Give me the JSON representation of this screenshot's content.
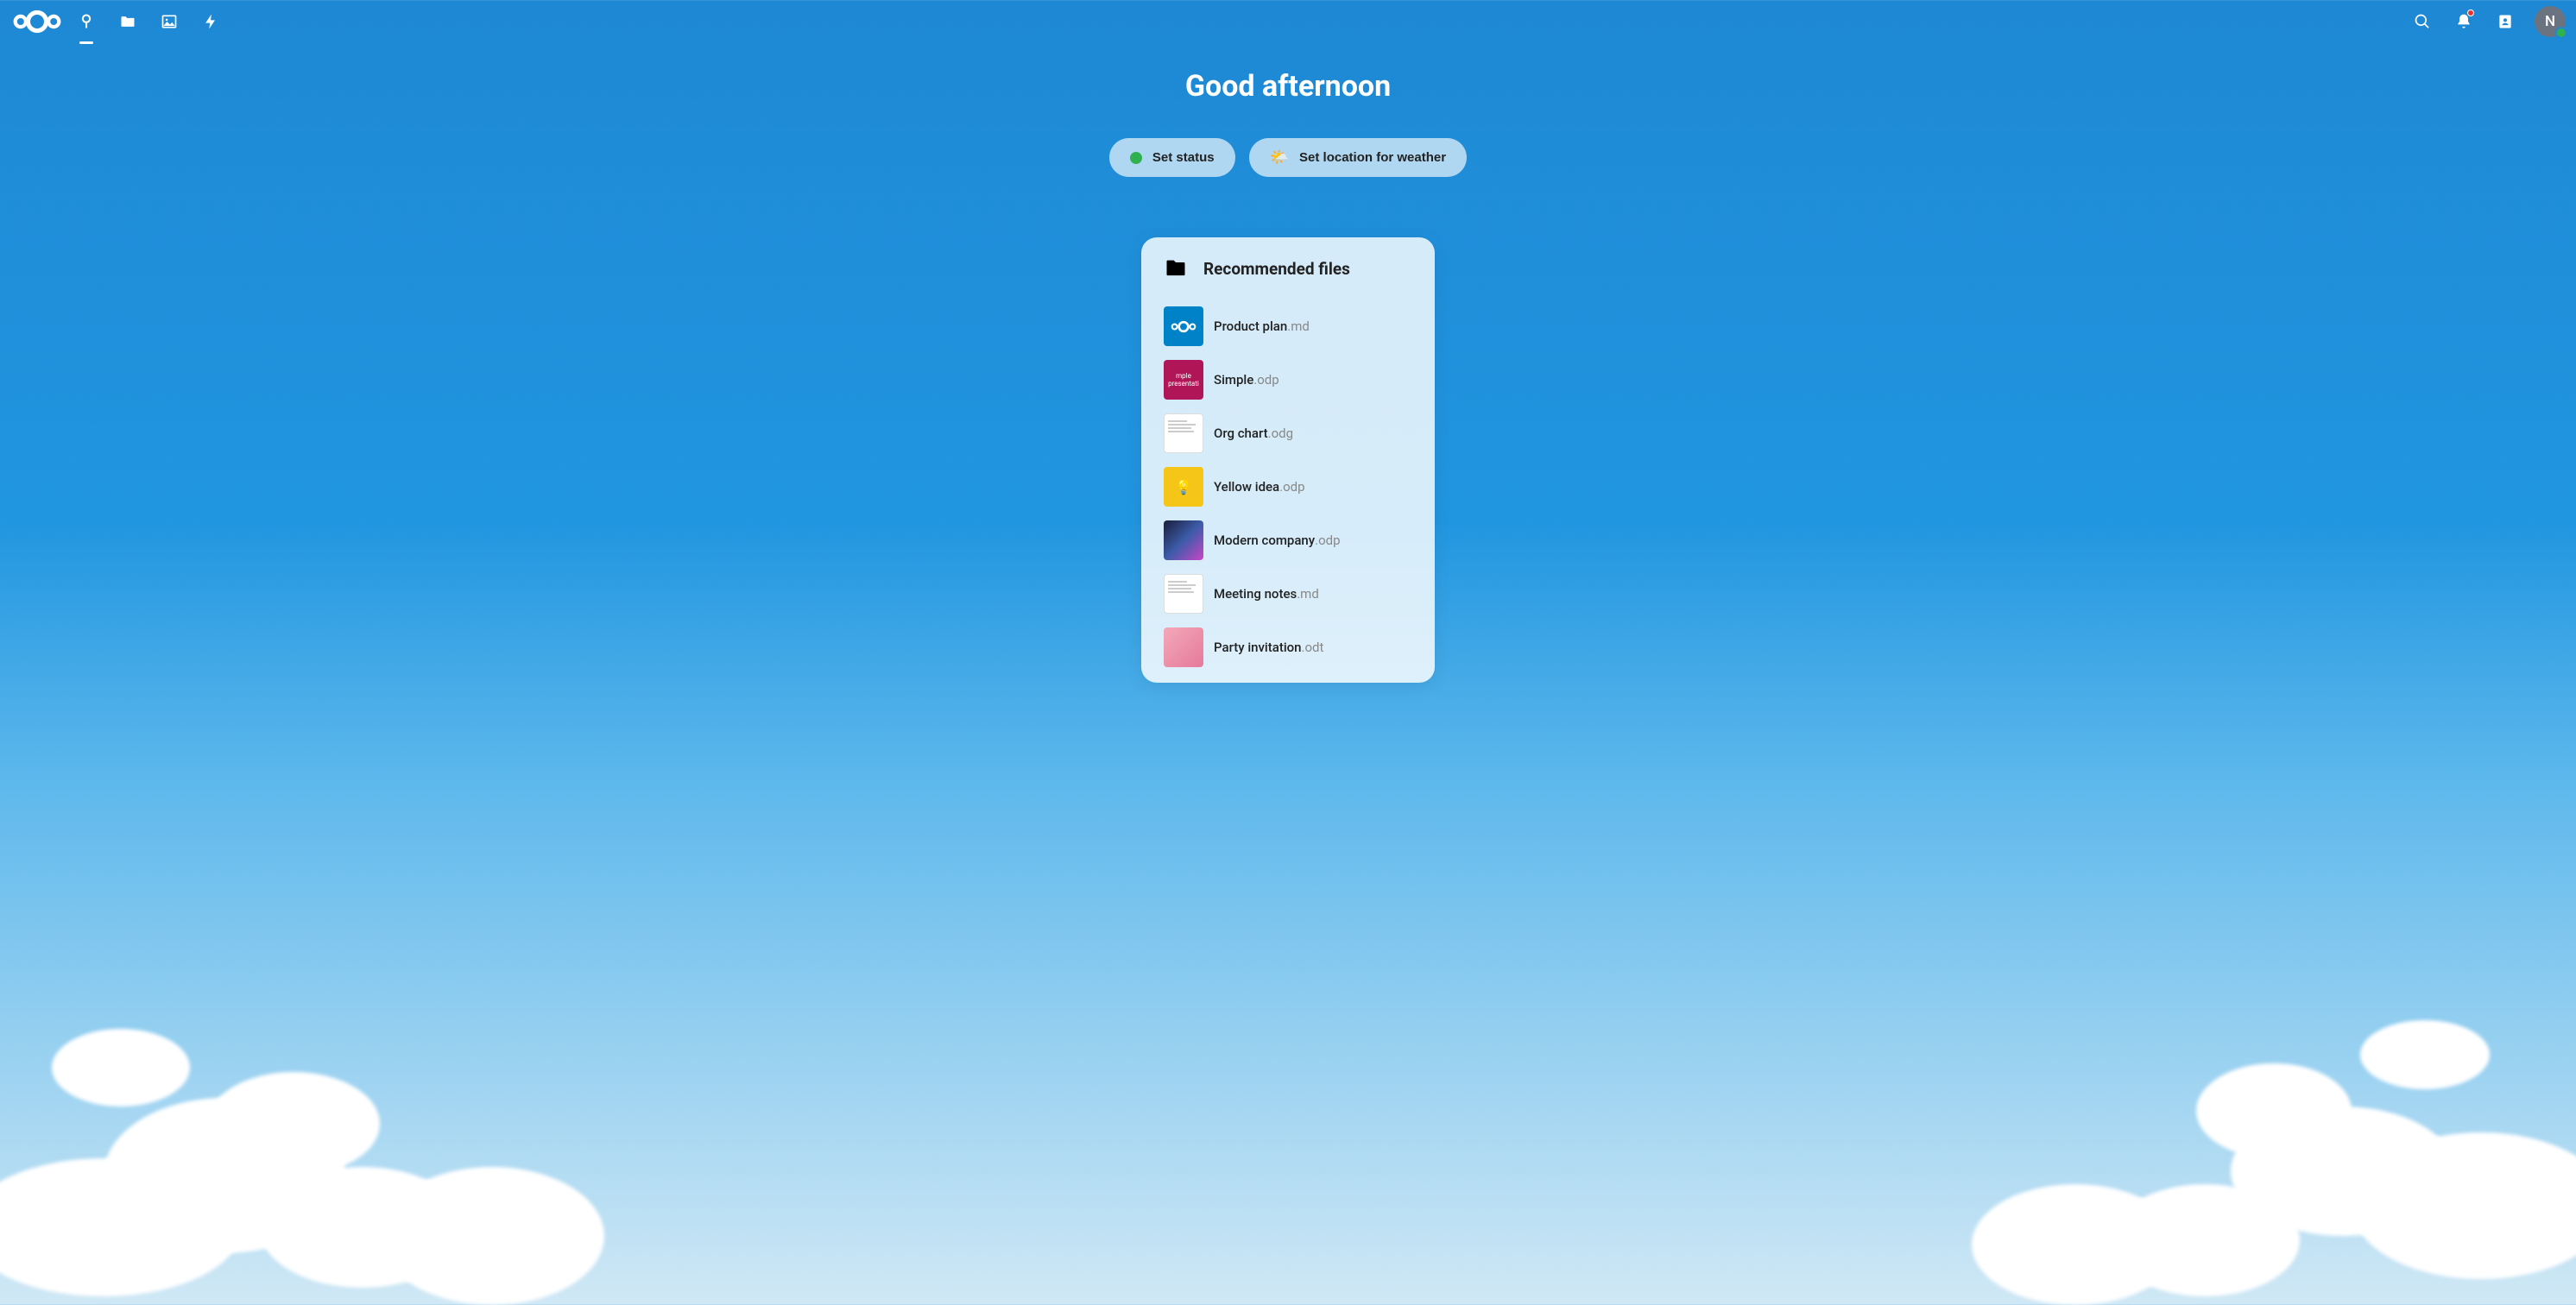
{
  "header": {
    "avatar_initial": "N"
  },
  "greeting": "Good afternoon",
  "buttons": {
    "set_status": "Set status",
    "set_location": "Set location for weather"
  },
  "card": {
    "title": "Recommended files",
    "files": [
      {
        "name": "Product plan",
        "ext": ".md",
        "thumb": "thumb-blue"
      },
      {
        "name": "Simple",
        "ext": ".odp",
        "thumb": "thumb-magenta"
      },
      {
        "name": "Org chart",
        "ext": ".odg",
        "thumb": "thumb-white"
      },
      {
        "name": "Yellow idea",
        "ext": ".odp",
        "thumb": "thumb-yellow"
      },
      {
        "name": "Modern company",
        "ext": ".odp",
        "thumb": "thumb-dark"
      },
      {
        "name": "Meeting notes",
        "ext": ".md",
        "thumb": "thumb-white"
      },
      {
        "name": "Party invitation",
        "ext": ".odt",
        "thumb": "thumb-pink"
      }
    ]
  }
}
